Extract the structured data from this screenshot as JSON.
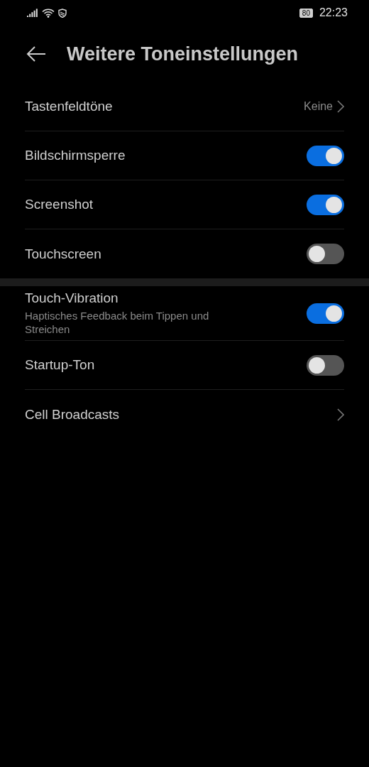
{
  "status_bar": {
    "battery": "80",
    "time": "22:23"
  },
  "header": {
    "title": "Weitere Toneinstellungen"
  },
  "sections": [
    {
      "items": [
        {
          "kind": "link",
          "label": "Tastenfeldtöne",
          "value": "Keine"
        },
        {
          "kind": "toggle",
          "label": "Bildschirmsperre",
          "on": true
        },
        {
          "kind": "toggle",
          "label": "Screenshot",
          "on": true
        },
        {
          "kind": "toggle",
          "label": "Touchscreen",
          "on": false
        }
      ]
    },
    {
      "items": [
        {
          "kind": "toggle",
          "label": "Touch-Vibration",
          "description": "Haptisches Feedback beim Tippen und Streichen",
          "on": true
        },
        {
          "kind": "toggle",
          "label": "Startup-Ton",
          "on": false
        },
        {
          "kind": "link",
          "label": "Cell Broadcasts"
        }
      ]
    }
  ]
}
